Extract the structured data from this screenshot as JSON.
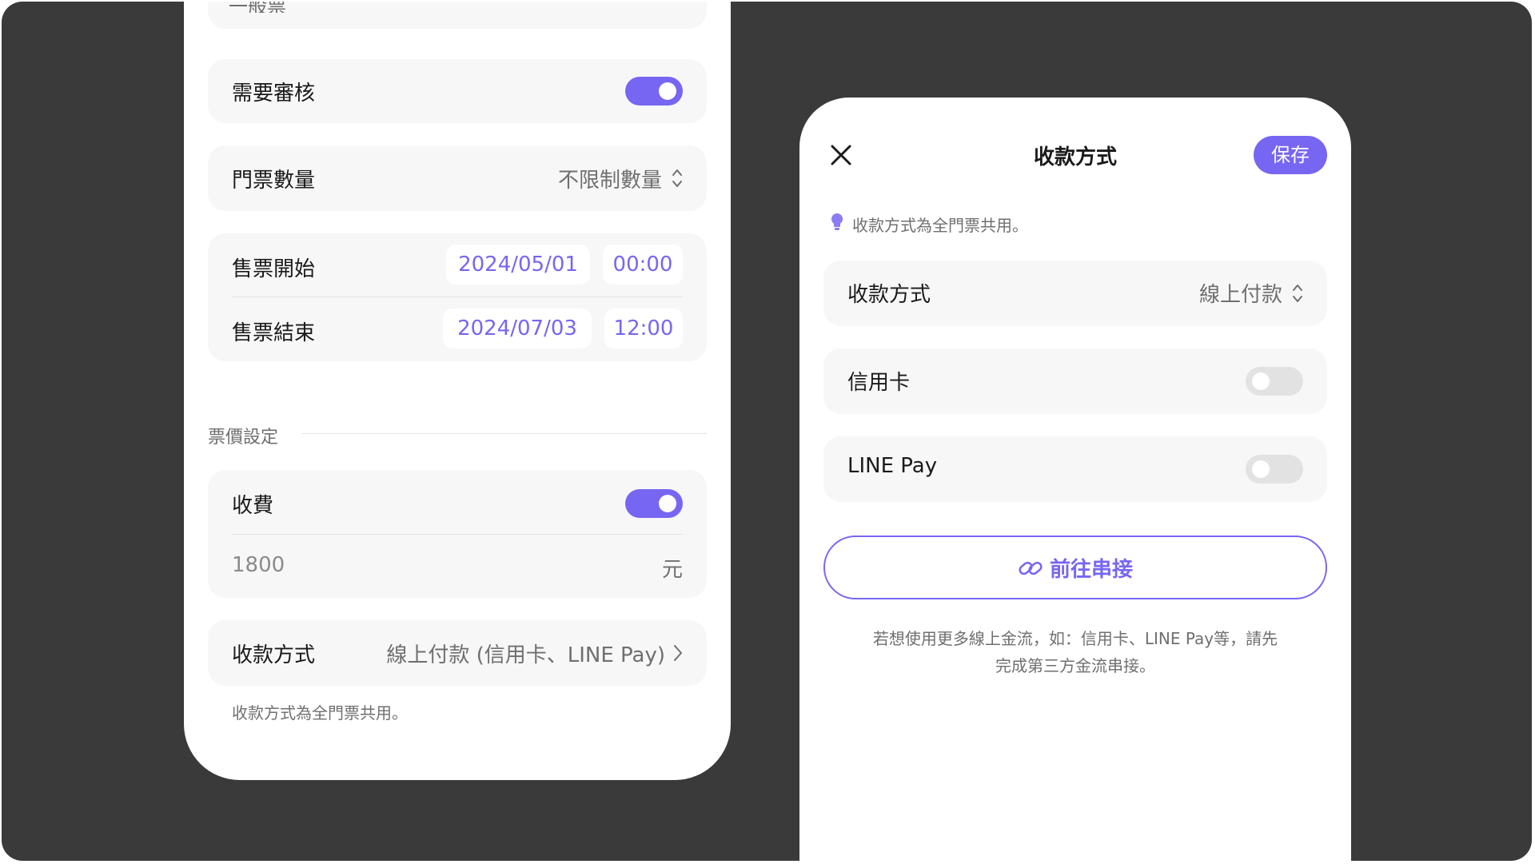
{
  "left": {
    "ticket_type_fragment": "一般票",
    "need_review": {
      "label": "需要審核",
      "enabled": true
    },
    "ticket_qty": {
      "label": "門票數量",
      "value": "不限制數量"
    },
    "sale_start": {
      "label": "售票開始",
      "date": "2024/05/01",
      "time": "00:00"
    },
    "sale_end": {
      "label": "售票結束",
      "date": "2024/07/03",
      "time": "12:00"
    },
    "price_section_title": "票價設定",
    "charge": {
      "label": "收費",
      "enabled": true,
      "amount": "1800",
      "unit": "元"
    },
    "payment": {
      "label": "收款方式",
      "value": "線上付款 (信用卡、LINE Pay)"
    },
    "payment_note": "收款方式為全門票共用。"
  },
  "right": {
    "title": "收款方式",
    "save_label": "保存",
    "hint": "收款方式為全門票共用。",
    "payment_method": {
      "label": "收款方式",
      "value": "線上付款"
    },
    "credit_card": {
      "label": "信用卡",
      "enabled": false
    },
    "line_pay": {
      "label": "LINE Pay",
      "enabled": false
    },
    "connect_label": "前往串接",
    "footer_line1": "若想使用更多線上金流，如：信用卡、LINE Pay等，請先",
    "footer_line2": "完成第三方金流串接。"
  },
  "colors": {
    "accent": "#7766f2",
    "backdrop": "#3a3a3a",
    "card": "#f7f7f7",
    "toggle_off": "#e2e2e2",
    "hint_bulb": "#8b7cf6"
  },
  "icons": {
    "close": "close-icon",
    "bulb": "lightbulb-icon",
    "link": "link-icon",
    "chevron_right": "chevron-right-icon",
    "updown": "chevron-updown-icon"
  }
}
